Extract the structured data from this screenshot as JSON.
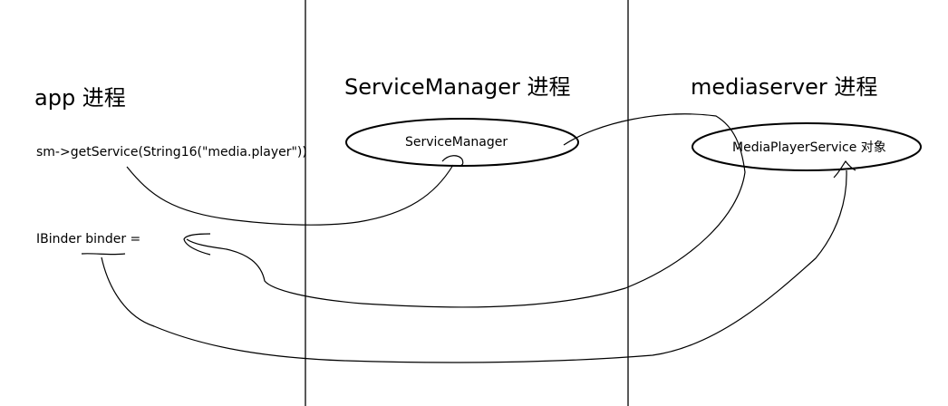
{
  "columns": {
    "app": "app 进程",
    "service_manager": "ServiceManager 进程",
    "mediaserver": "mediaserver 进程"
  },
  "code": {
    "get_service": "sm->getService(String16(\"media.player\"))",
    "binder_assign": "IBinder binder ="
  },
  "nodes": {
    "service_manager": "ServiceManager",
    "media_player_service": "MediaPlayerService 对象"
  },
  "colors": {
    "stroke": "#000000",
    "background": "#ffffff"
  }
}
